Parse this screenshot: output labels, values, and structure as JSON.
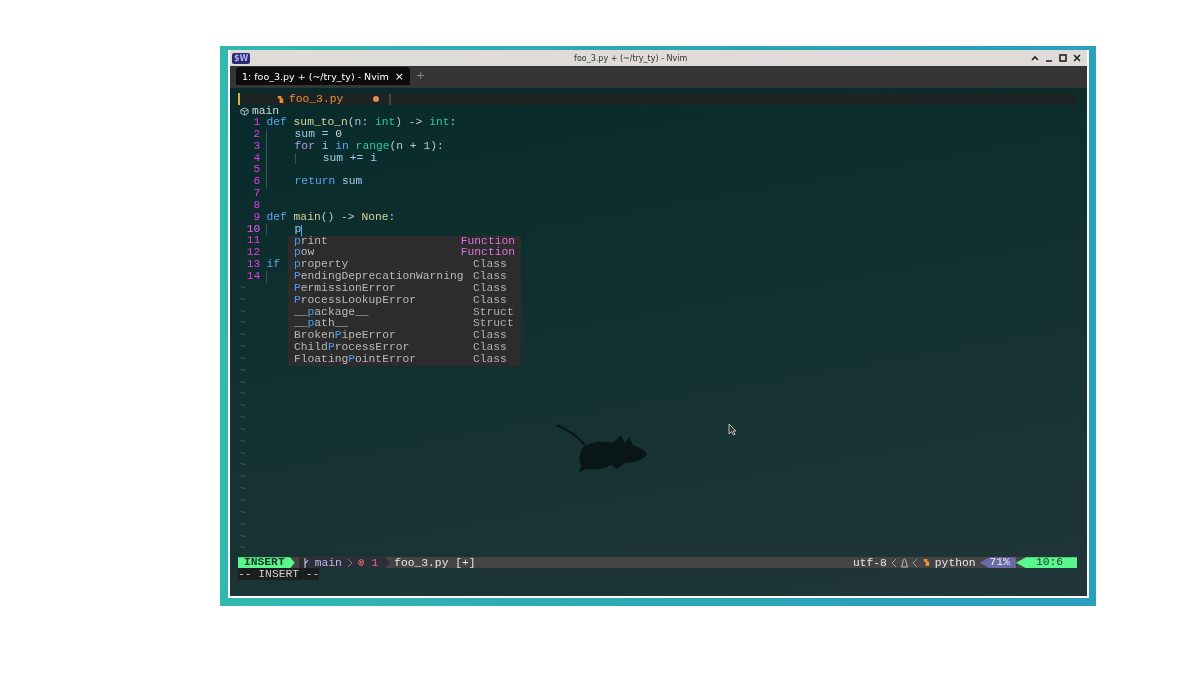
{
  "window": {
    "title": "foo_3.py + (~/try_ty) - Nvim",
    "app_badge": "$W"
  },
  "tabs": [
    {
      "label": "1: foo_3.py + (~/try_ty) - Nvim",
      "selected": true,
      "close": "×"
    }
  ],
  "new_tab": "+",
  "buffer_tab": {
    "name": "foo_3.py",
    "modified": true
  },
  "breadcrumb": "main",
  "lines": [
    {
      "number": "1",
      "tokens": [
        {
          "text": "def",
          "kind": "keyword"
        },
        {
          "text": " sum_to_n",
          "kind": "function"
        },
        {
          "text": "(",
          "kind": "punct"
        },
        {
          "text": "n",
          "kind": "param"
        },
        {
          "text": ": ",
          "kind": "punct"
        },
        {
          "text": "int",
          "kind": "type"
        },
        {
          "text": ") -> ",
          "kind": "punct"
        },
        {
          "text": "int",
          "kind": "type"
        },
        {
          "text": ":",
          "kind": "punct"
        }
      ]
    },
    {
      "number": "2",
      "tokens": [
        {
          "kind": "indent"
        },
        {
          "text": "sum = ",
          "kind": "variable"
        },
        {
          "text": "0",
          "kind": "number"
        }
      ]
    },
    {
      "number": "3",
      "tokens": [
        {
          "kind": "indent"
        },
        {
          "text": "for",
          "kind": "control"
        },
        {
          "text": " i ",
          "kind": "variable"
        },
        {
          "text": "in",
          "kind": "keyword"
        },
        {
          "text": " range",
          "kind": "type"
        },
        {
          "text": "(n + 1):",
          "kind": "punct"
        }
      ]
    },
    {
      "number": "4",
      "tokens": [
        {
          "kind": "indent"
        },
        {
          "kind": "indent"
        },
        {
          "text": "sum += i",
          "kind": "variable"
        }
      ]
    },
    {
      "number": "5",
      "tokens": [
        {
          "kind": "indent"
        }
      ]
    },
    {
      "number": "6",
      "tokens": [
        {
          "kind": "indent"
        },
        {
          "text": "return",
          "kind": "keyword"
        },
        {
          "text": " sum",
          "kind": "variable"
        }
      ]
    },
    {
      "number": "7"
    },
    {
      "number": "8"
    },
    {
      "number": "9",
      "tokens": [
        {
          "text": "def",
          "kind": "keyword"
        },
        {
          "text": " main",
          "kind": "function"
        },
        {
          "text": "() -> ",
          "kind": "punct"
        },
        {
          "text": "None",
          "kind": "function"
        },
        {
          "text": ":",
          "kind": "punct"
        }
      ]
    },
    {
      "number": "10",
      "cursor": true,
      "tokens": [
        {
          "kind": "indent"
        },
        {
          "text": "p",
          "kind": "variable"
        }
      ]
    },
    {
      "number": "11"
    },
    {
      "number": "12"
    },
    {
      "number": "13",
      "tokens": [
        {
          "text": "if",
          "kind": "keyword"
        }
      ]
    },
    {
      "number": "14",
      "tokens": [
        {
          "kind": "indent"
        }
      ]
    }
  ],
  "empty_lines": [
    "~",
    "~",
    "~",
    "~",
    "~",
    "~",
    "~",
    "~",
    "~",
    "~",
    "~",
    "~",
    "~",
    "~",
    "~",
    "~",
    "~",
    "~",
    "~",
    "~",
    "~",
    "~",
    "~"
  ],
  "completion": {
    "items": [
      {
        "match": "p",
        "after": "rint",
        "kind": "Function"
      },
      {
        "match": "p",
        "after": "ow",
        "kind": "Function"
      },
      {
        "match": "p",
        "after": "roperty",
        "kind": "Class"
      },
      {
        "match": "P",
        "after": "endingDeprecationWarning",
        "kind": "Class"
      },
      {
        "match": "P",
        "after": "ermissionError",
        "kind": "Class"
      },
      {
        "match": "P",
        "after": "rocessLookupError",
        "kind": "Class"
      },
      {
        "before": "__",
        "match": "p",
        "after": "ackage__",
        "kind": "Struct"
      },
      {
        "before": "__",
        "match": "p",
        "after": "ath__",
        "kind": "Struct"
      },
      {
        "before": "Broken",
        "match": "P",
        "after": "ipeError",
        "kind": "Class"
      },
      {
        "before": "Child",
        "match": "P",
        "after": "rocessError",
        "kind": "Class"
      },
      {
        "before": "Floating",
        "match": "P",
        "after": "ointError",
        "kind": "Class"
      }
    ]
  },
  "statusline": {
    "mode": "INSERT",
    "branch": "main",
    "errors": "⊗ 1",
    "file": "foo_3.py [+]",
    "encoding": "utf-8",
    "filetype": "python",
    "progress": "71%",
    "position": "10:6"
  },
  "cmdline": "-- INSERT --"
}
